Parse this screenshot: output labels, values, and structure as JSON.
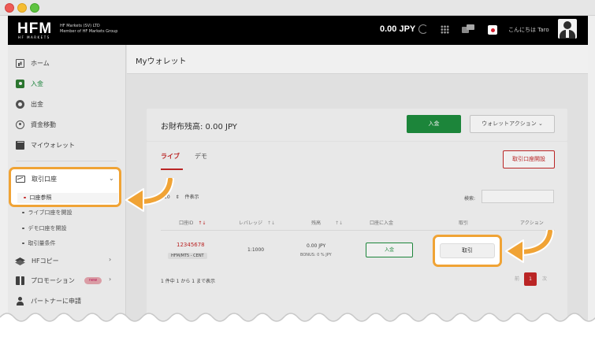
{
  "header": {
    "logo_text": "HFM",
    "logo_sub": "HF MARKETS",
    "company_line1": "HF Markets (SV) LTD",
    "company_line2": "Member of HF Markets Group",
    "balance": "0.00 JPY",
    "greeting": "こんにちは Taro"
  },
  "sidebar": {
    "items": [
      {
        "label": "ホーム"
      },
      {
        "label": "入金"
      },
      {
        "label": "出金"
      },
      {
        "label": "資金移動"
      },
      {
        "label": "マイウォレット"
      }
    ],
    "trading_accounts": {
      "label": "取引口座",
      "chevron": "⌄",
      "subitems": [
        {
          "label": "口座参照"
        },
        {
          "label": "ライブ口座を開設"
        },
        {
          "label": "デモ口座を開設"
        },
        {
          "label": "取引量条件"
        }
      ]
    },
    "hfcopy": {
      "label": "HFコピー",
      "chevron": "›"
    },
    "promotion": {
      "label": "プロモーション",
      "badge": "new",
      "chevron": "›"
    },
    "partner": {
      "label": "パートナーに申請"
    }
  },
  "main": {
    "page_title": "Myウォレット",
    "wallet_balance": "お財布残高: 0.00 JPY",
    "deposit_label": "入金",
    "wallet_action_label": "ウォレットアクション ⌄",
    "tabs": [
      {
        "label": "ライブ"
      },
      {
        "label": "デモ"
      }
    ],
    "open_account_label": "取引口座開設",
    "page_length": "10",
    "length_suffix": "件表示",
    "length_arrow": "⇕",
    "search_label": "検索:",
    "columns": [
      {
        "label": "口座ID",
        "sort": "↑↓"
      },
      {
        "label": "レバレッジ",
        "sort": "↑↓"
      },
      {
        "label": "残高",
        "sort": "↑↓"
      },
      {
        "label": "口座に入金",
        "sort": "↑↓"
      },
      {
        "label": "取引"
      },
      {
        "label": "アクション"
      }
    ],
    "rows": [
      {
        "account_id": "12345678",
        "account_type": "HFM/MT5 - CENT",
        "leverage": "1:1000",
        "balance": "0.00 JPY",
        "bonus": "BONUS: 0 % JPY",
        "deposit_button": "入金",
        "trade_button": "取引"
      }
    ],
    "info": "1 件中 1 から 1 まで表示",
    "pager": {
      "prev": "前",
      "current": "1",
      "next": "次"
    }
  },
  "colors": {
    "accent_red": "#c62828",
    "accent_green": "#1e8e3e",
    "highlight_orange": "#f0a335"
  }
}
